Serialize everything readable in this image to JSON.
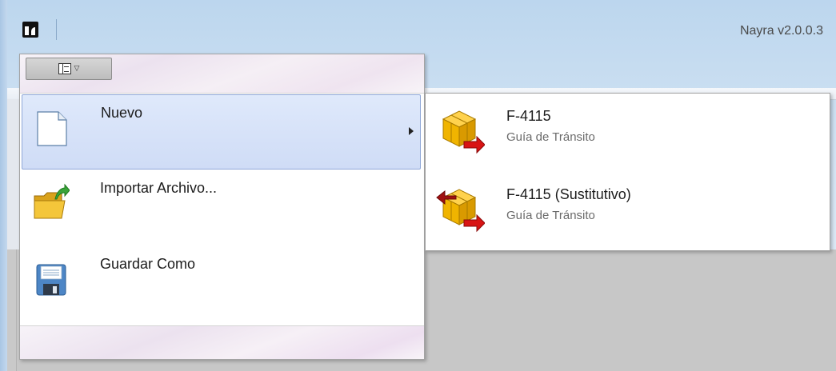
{
  "titlebar": {
    "version": "Nayra v2.0.0.3"
  },
  "menu": {
    "toggle_icon": "menu-toggle-icon",
    "items": [
      {
        "label": "Nuevo",
        "icon": "new-document-icon",
        "has_submenu": true,
        "selected": true
      },
      {
        "label": "Importar Archivo...",
        "icon": "import-folder-icon",
        "has_submenu": false,
        "selected": false
      },
      {
        "label": "Guardar Como",
        "icon": "floppy-disk-icon",
        "has_submenu": false,
        "selected": false
      }
    ]
  },
  "submenu": {
    "items": [
      {
        "title": "F-4115",
        "description": "Guía de Tránsito",
        "icon": "package-out-icon"
      },
      {
        "title": "F-4115 (Sustitutivo)",
        "description": "Guía de Tránsito",
        "icon": "package-swap-icon"
      }
    ]
  },
  "colors": {
    "selected_bg": "#cfdcf6",
    "selected_border": "#8fa7d7",
    "cube": "#f0b400",
    "arrow": "#d81414"
  }
}
